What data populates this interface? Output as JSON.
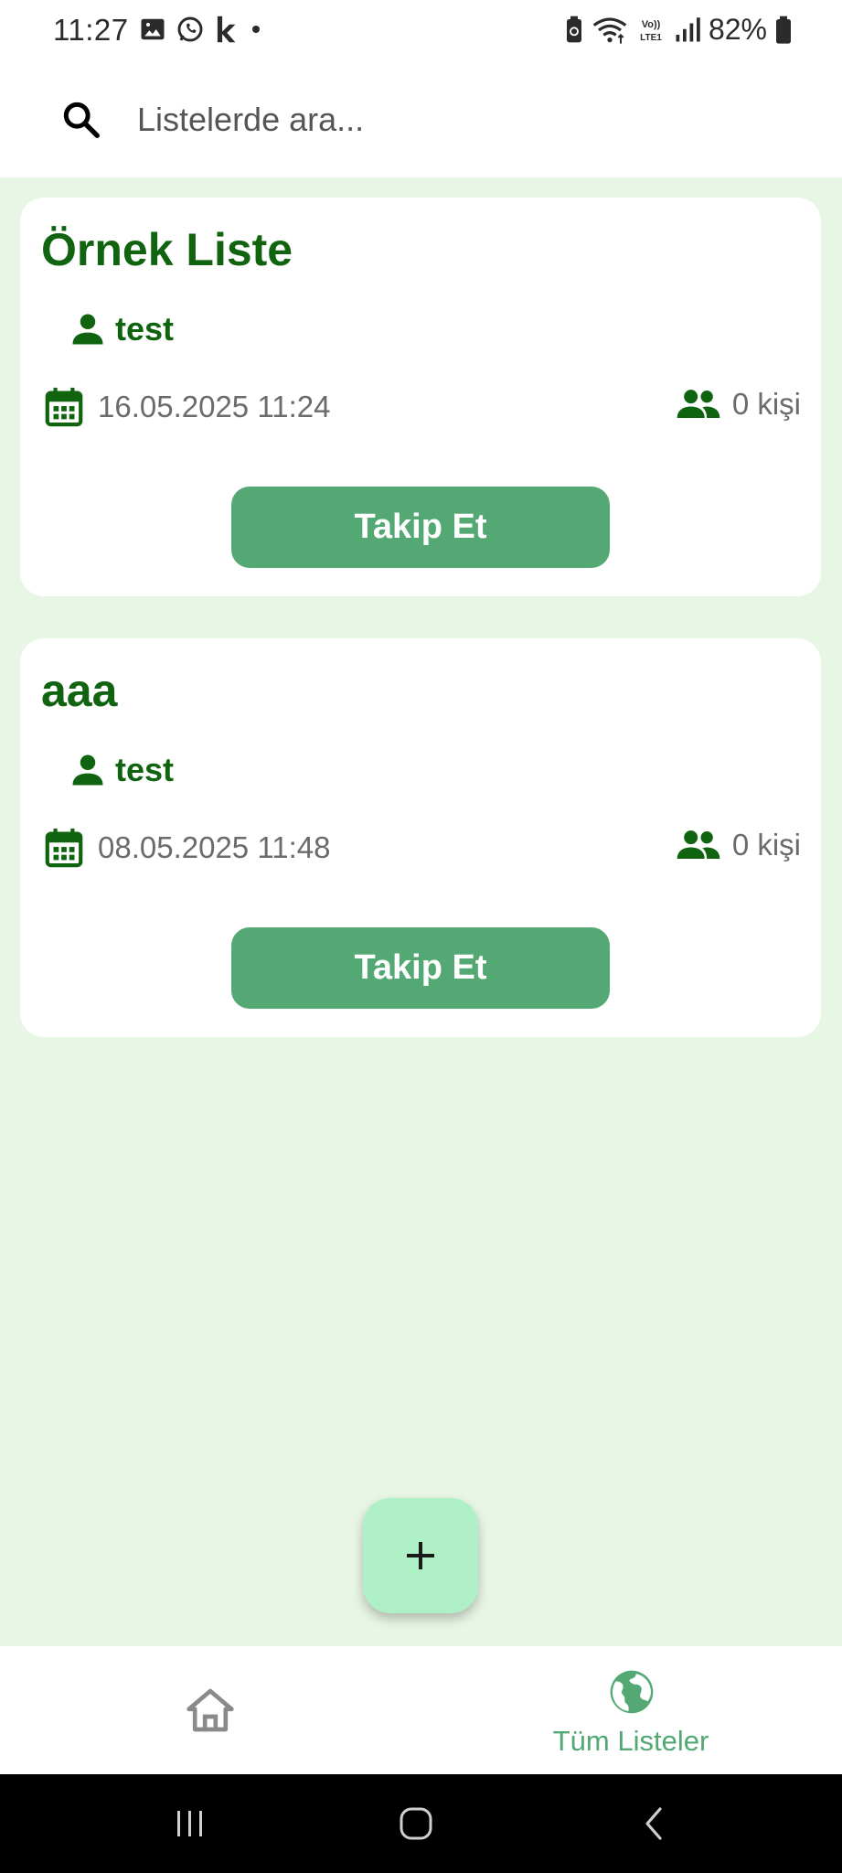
{
  "status_bar": {
    "time": "11:27",
    "battery": "82%",
    "icons": [
      "gallery-icon",
      "whatsapp-icon",
      "k-app-icon",
      "dot-icon",
      "battery-saver-icon",
      "wifi-icon",
      "volte-icon",
      "signal-icon",
      "battery-icon"
    ]
  },
  "search": {
    "placeholder": "Listelerde ara..."
  },
  "lists": [
    {
      "title": "Örnek Liste",
      "owner": "test",
      "date": "16.05.2025 11:24",
      "followers": "0 kişi",
      "action": "Takip Et"
    },
    {
      "title": "aaa",
      "owner": "test",
      "date": "08.05.2025 11:48",
      "followers": "0 kişi",
      "action": "Takip Et"
    }
  ],
  "fab": {
    "icon": "plus-icon"
  },
  "bottom_nav": {
    "items": [
      {
        "icon": "home-icon",
        "label": ""
      },
      {
        "icon": "globe-icon",
        "label": "Tüm Listeler"
      }
    ]
  },
  "colors": {
    "primary": "#106410",
    "accent": "#54a874",
    "background": "#e8f6e6",
    "fab": "#b0f0c6"
  }
}
